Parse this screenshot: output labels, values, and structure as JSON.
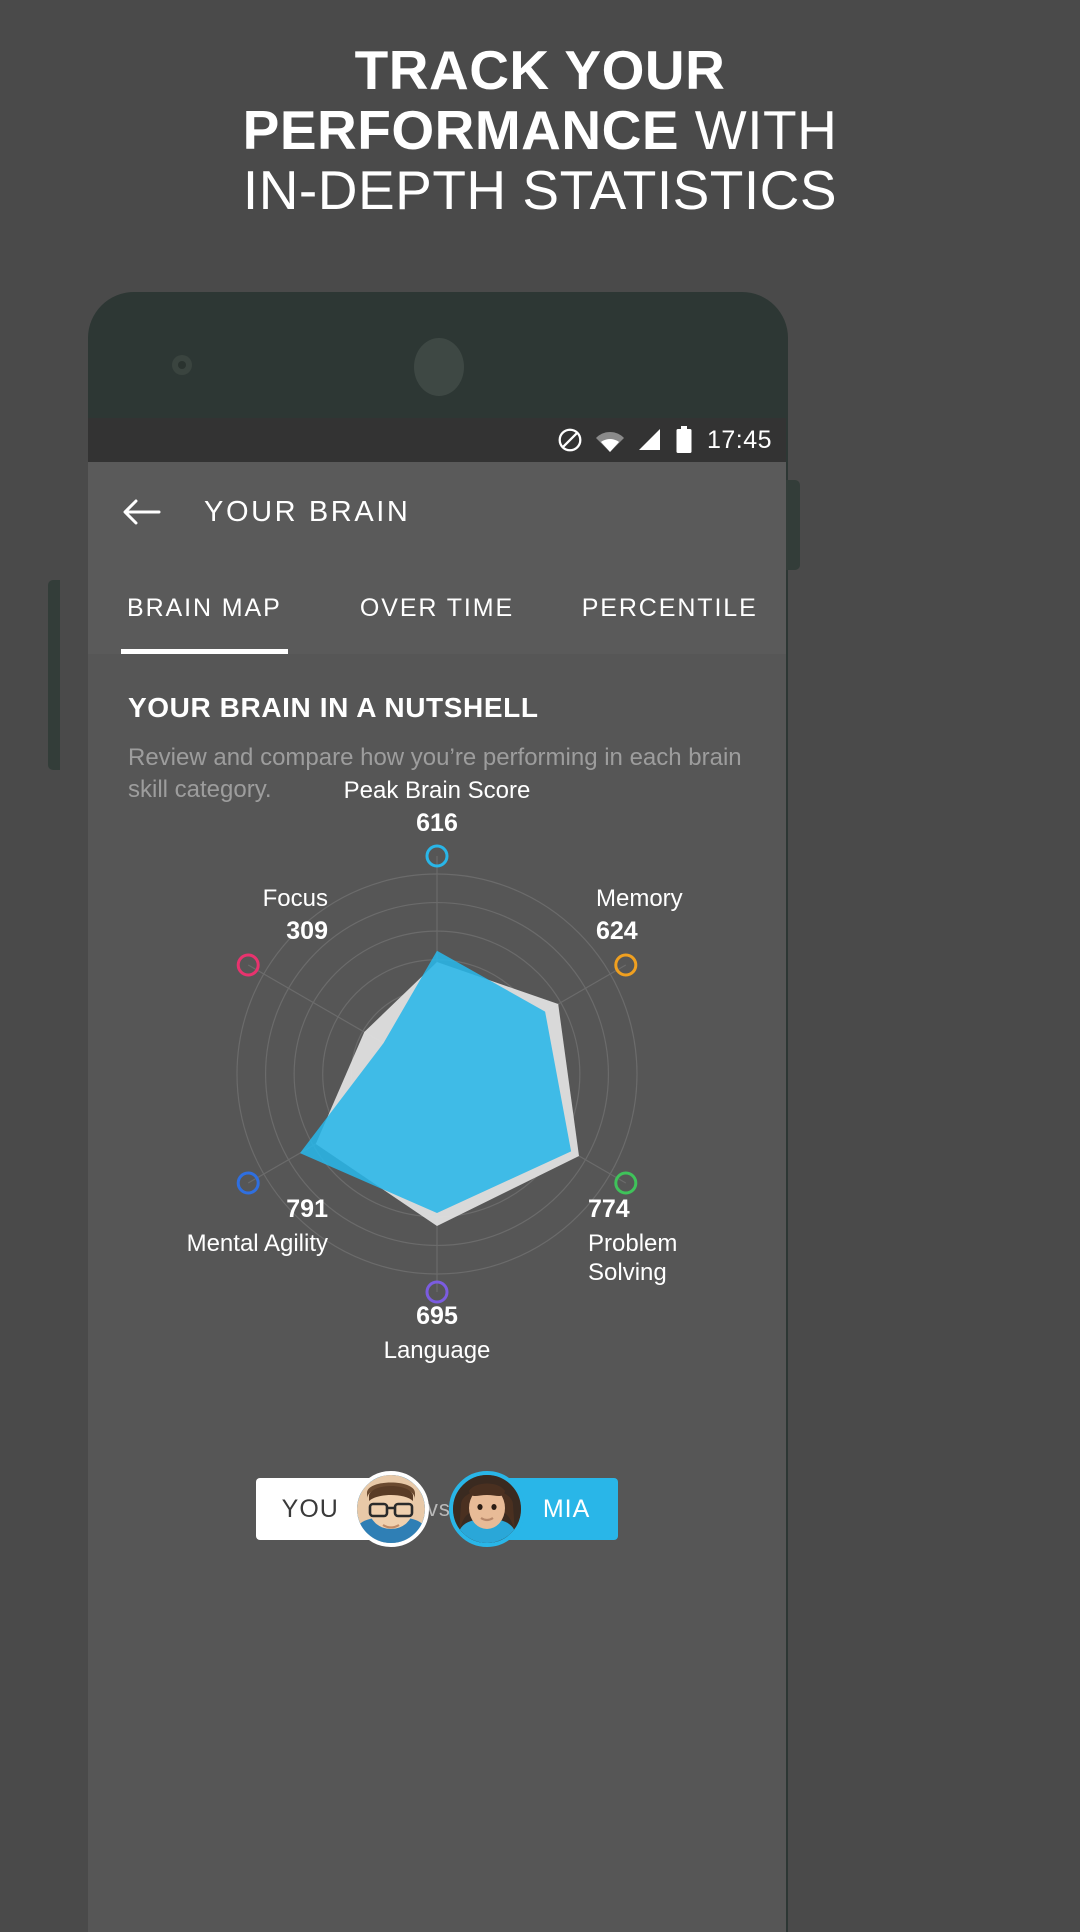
{
  "marketing": {
    "headline_lines": [
      {
        "bold": "TRACK YOUR",
        "light": ""
      },
      {
        "bold": "PERFORMANCE",
        "light": " WITH"
      },
      {
        "bold": "",
        "light": "IN-DEPTH STATISTICS"
      }
    ],
    "line1_bold": "TRACK YOUR",
    "line2_bold": "PERFORMANCE",
    "line2_light": " WITH",
    "line3_light": "IN-DEPTH STATISTICS",
    "background_color": "#4a4a4a"
  },
  "status_bar": {
    "time": "17:45",
    "icons": [
      "do-not-disturb-icon",
      "wifi-icon",
      "cell-signal-icon",
      "battery-icon"
    ]
  },
  "toolbar": {
    "back_label": "back-arrow-icon",
    "title": "YOUR BRAIN"
  },
  "tabs": [
    {
      "label": "BRAIN MAP",
      "active": true
    },
    {
      "label": "OVER TIME",
      "active": false
    },
    {
      "label": "PERCENTILE",
      "active": false
    }
  ],
  "section": {
    "title": "YOUR BRAIN IN A NUTSHELL",
    "description": "Review and compare how you’re performing in each brain skill category."
  },
  "legend": {
    "you_label": "YOU",
    "vs_label": "vs",
    "mia_label": "MIA",
    "you_color": "#ffffff",
    "mia_color": "#29b6e8"
  },
  "chart_data": {
    "type": "radar",
    "title": "YOUR BRAIN IN A NUTSHELL",
    "categories": [
      "Peak Brain Score",
      "Memory",
      "Problem Solving",
      "Language",
      "Mental Agility",
      "Focus"
    ],
    "values": [
      616,
      624,
      774,
      695,
      791,
      309
    ],
    "axis_colors": [
      "#29b6e8",
      "#f0a020",
      "#3fc25a",
      "#7b5ce0",
      "#2f6fe0",
      "#e8336e"
    ],
    "series": [
      {
        "name": "YOU",
        "color": "#29b6e8",
        "values": [
          616,
          624,
          774,
          695,
          791,
          309
        ]
      },
      {
        "name": "MIA",
        "color": "#e4e4e4",
        "values": [
          560,
          700,
          820,
          760,
          700,
          420
        ]
      }
    ],
    "max": 1000,
    "rings": 7,
    "grid": true,
    "legend_position": "bottom"
  }
}
